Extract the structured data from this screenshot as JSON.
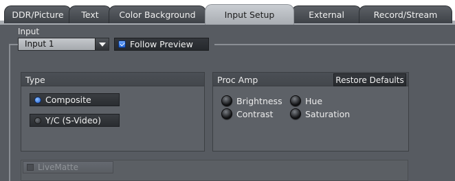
{
  "tabs": [
    {
      "label": "DDR/Picture"
    },
    {
      "label": "Text"
    },
    {
      "label": "Color Background"
    },
    {
      "label": "Input Setup",
      "active": true
    },
    {
      "label": "External"
    },
    {
      "label": "Record/Stream"
    }
  ],
  "input": {
    "label": "Input",
    "selected": "Input 1",
    "follow_preview": {
      "label": "Follow Preview",
      "checked": true
    }
  },
  "type_group": {
    "title": "Type",
    "options": [
      {
        "label": "Composite",
        "selected": true
      },
      {
        "label": "Y/C (S-Video)",
        "selected": false
      }
    ]
  },
  "proc_amp": {
    "title": "Proc Amp",
    "restore_label": "Restore Defaults",
    "controls": [
      {
        "label": "Brightness"
      },
      {
        "label": "Hue"
      },
      {
        "label": "Contrast"
      },
      {
        "label": "Saturation"
      }
    ]
  },
  "livematte": {
    "label": "LiveMatte",
    "checked": false,
    "enabled": false
  },
  "colors": {
    "active_tab": "#b9bdc2",
    "panel": "#575b61",
    "accent_blue": "#1e5fcf"
  },
  "icons": {
    "dropdown": "chevron-down-icon",
    "radio_on": "radio-selected-icon",
    "radio_off": "radio-unselected-icon",
    "knob": "knob-icon"
  }
}
